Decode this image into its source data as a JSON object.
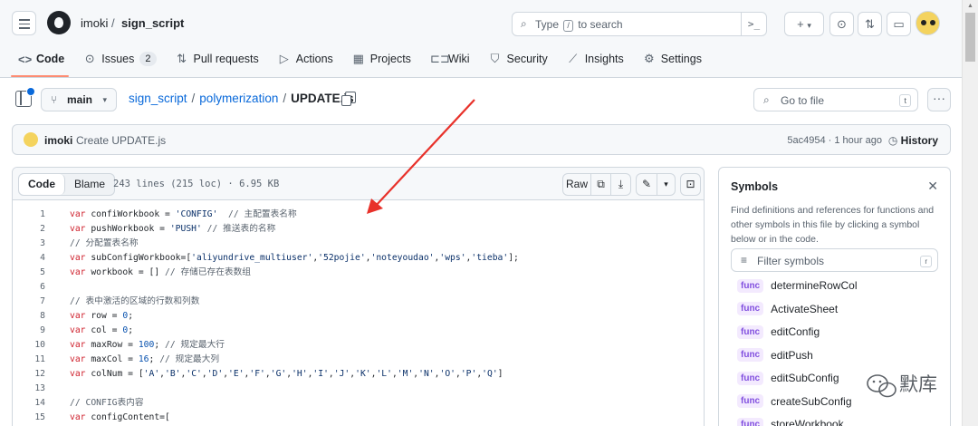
{
  "header": {
    "owner": "imoki",
    "repo": "sign_script",
    "search_prefix": "Type",
    "search_slash": "/",
    "search_suffix": "to search",
    "command_glyph": ">_",
    "plus_label": "+",
    "caret_label": "▾"
  },
  "nav": {
    "items": [
      {
        "label": "Code",
        "icon": "code-icon",
        "glyph": "<>"
      },
      {
        "label": "Issues",
        "icon": "issue-icon",
        "glyph": "⊙",
        "count": "2"
      },
      {
        "label": "Pull requests",
        "icon": "pull-request-icon",
        "glyph": "⇅"
      },
      {
        "label": "Actions",
        "icon": "play-icon",
        "glyph": "▷"
      },
      {
        "label": "Projects",
        "icon": "table-icon",
        "glyph": "▦"
      },
      {
        "label": "Wiki",
        "icon": "book-icon",
        "glyph": "⊏⊐"
      },
      {
        "label": "Security",
        "icon": "shield-icon",
        "glyph": "⛉"
      },
      {
        "label": "Insights",
        "icon": "graph-icon",
        "glyph": "⟋"
      },
      {
        "label": "Settings",
        "icon": "gear-icon",
        "glyph": "⚙"
      }
    ]
  },
  "file": {
    "branch": "main",
    "path_repo": "sign_script",
    "path_dir": "polymerization",
    "path_file": "UPDATE.js",
    "sep": "/",
    "goto_placeholder": "Go to file",
    "goto_key": "t"
  },
  "commit": {
    "author": "imoki",
    "message": "Create UPDATE.js",
    "meta": "5ac4954 · 1 hour ago",
    "history_label": "History"
  },
  "codeview": {
    "tab_code": "Code",
    "tab_blame": "Blame",
    "stats": "243 lines (215 loc) · 6.95 KB",
    "raw_label": "Raw",
    "lines": [
      {
        "n": "1",
        "html": [
          [
            "kw",
            "var"
          ],
          [
            "",
            "confiWorkbook = "
          ],
          [
            "str",
            "'CONFIG'"
          ],
          [
            "",
            "  "
          ],
          [
            "cm",
            "// 主配置表名称"
          ]
        ]
      },
      {
        "n": "2",
        "html": [
          [
            "kw",
            "var"
          ],
          [
            "",
            "pushWorkbook = "
          ],
          [
            "str",
            "'PUSH'"
          ],
          [
            "cm",
            " // 推送表的名称"
          ]
        ]
      },
      {
        "n": "3",
        "html": [
          [
            "cm",
            "// 分配置表名称"
          ]
        ]
      },
      {
        "n": "4",
        "html": [
          [
            "kw",
            "var"
          ],
          [
            "",
            "subConfigWorkbook=["
          ],
          [
            "str",
            "'aliyundrive_multiuser'"
          ],
          [
            "",
            ","
          ],
          [
            "str",
            "'52pojie'"
          ],
          [
            "",
            ","
          ],
          [
            "str",
            "'noteyoudao'"
          ],
          [
            "",
            ","
          ],
          [
            "str",
            "'wps'"
          ],
          [
            "",
            ","
          ],
          [
            "str",
            "'tieba'"
          ],
          [
            "",
            "];"
          ]
        ]
      },
      {
        "n": "5",
        "html": [
          [
            "kw",
            "var"
          ],
          [
            "",
            "workbook = [] "
          ],
          [
            "cm",
            "// 存储已存在表数组"
          ]
        ]
      },
      {
        "n": "6",
        "html": []
      },
      {
        "n": "7",
        "html": [
          [
            "cm",
            "// 表中激活的区域的行数和列数"
          ]
        ]
      },
      {
        "n": "8",
        "html": [
          [
            "kw",
            "var"
          ],
          [
            "",
            "row = "
          ],
          [
            "num",
            "0"
          ],
          [
            "",
            ";"
          ]
        ]
      },
      {
        "n": "9",
        "html": [
          [
            "kw",
            "var"
          ],
          [
            "",
            "col = "
          ],
          [
            "num",
            "0"
          ],
          [
            "",
            ";"
          ]
        ]
      },
      {
        "n": "10",
        "html": [
          [
            "kw",
            "var"
          ],
          [
            "",
            "maxRow = "
          ],
          [
            "num",
            "100"
          ],
          [
            "",
            "; "
          ],
          [
            "cm",
            "// 规定最大行"
          ]
        ]
      },
      {
        "n": "11",
        "html": [
          [
            "kw",
            "var"
          ],
          [
            "",
            "maxCol = "
          ],
          [
            "num",
            "16"
          ],
          [
            "",
            "; "
          ],
          [
            "cm",
            "// 规定最大列"
          ]
        ]
      },
      {
        "n": "12",
        "html": [
          [
            "kw",
            "var"
          ],
          [
            "",
            "colNum = ["
          ],
          [
            "str",
            "'A'"
          ],
          [
            "",
            ","
          ],
          [
            "str",
            "'B'"
          ],
          [
            "",
            ","
          ],
          [
            "str",
            "'C'"
          ],
          [
            "",
            ","
          ],
          [
            "str",
            "'D'"
          ],
          [
            "",
            ","
          ],
          [
            "str",
            "'E'"
          ],
          [
            "",
            ","
          ],
          [
            "str",
            "'F'"
          ],
          [
            "",
            ","
          ],
          [
            "str",
            "'G'"
          ],
          [
            "",
            ","
          ],
          [
            "str",
            "'H'"
          ],
          [
            "",
            ","
          ],
          [
            "str",
            "'I'"
          ],
          [
            "",
            ","
          ],
          [
            "str",
            "'J'"
          ],
          [
            "",
            ","
          ],
          [
            "str",
            "'K'"
          ],
          [
            "",
            ","
          ],
          [
            "str",
            "'L'"
          ],
          [
            "",
            ","
          ],
          [
            "str",
            "'M'"
          ],
          [
            "",
            ","
          ],
          [
            "str",
            "'N'"
          ],
          [
            "",
            ","
          ],
          [
            "str",
            "'O'"
          ],
          [
            "",
            ","
          ],
          [
            "str",
            "'P'"
          ],
          [
            "",
            ","
          ],
          [
            "str",
            "'Q'"
          ],
          [
            "",
            "]"
          ]
        ]
      },
      {
        "n": "13",
        "html": []
      },
      {
        "n": "14",
        "html": [
          [
            "cm",
            "// CONFIG表内容"
          ]
        ]
      },
      {
        "n": "15",
        "html": [
          [
            "kw",
            "var"
          ],
          [
            "",
            "configContent=["
          ]
        ]
      }
    ]
  },
  "symbols": {
    "title": "Symbols",
    "description": "Find definitions and references for functions and other symbols in this file by clicking a symbol below or in the code.",
    "filter_placeholder": "Filter symbols",
    "filter_key": "r",
    "badge": "func",
    "items": [
      "determineRowCol",
      "ActivateSheet",
      "editConfig",
      "editPush",
      "editSubConfig",
      "createSubConfig",
      "storeWorkbook"
    ]
  },
  "watermark": {
    "text": "默库"
  },
  "colors": {
    "accent": "#0969da",
    "underline": "#fd8c73",
    "arrow": "#e8312a"
  }
}
